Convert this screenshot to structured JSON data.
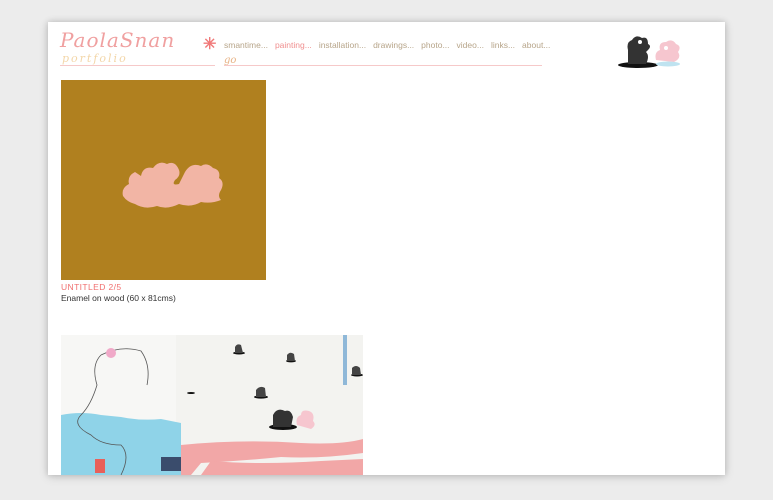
{
  "site": {
    "logo_text": "PaolaSnan",
    "logo_sub": "portfolio"
  },
  "nav": {
    "items": [
      {
        "label": "smantime..."
      },
      {
        "label": "painting..."
      },
      {
        "label": "installation..."
      },
      {
        "label": "drawings..."
      },
      {
        "label": "photo..."
      },
      {
        "label": "video..."
      },
      {
        "label": "links..."
      },
      {
        "label": "about..."
      }
    ],
    "active_index": 1,
    "go_label": "go"
  },
  "artworks": [
    {
      "title": "UNTITLED 2/5",
      "description": "Enamel on wood (60 x 81cms)"
    }
  ],
  "colors": {
    "accent_pink": "#f07070",
    "nav_text": "#b7a58a",
    "painting_ochre": "#b0801f",
    "shape_pink": "#f2b5a5"
  }
}
